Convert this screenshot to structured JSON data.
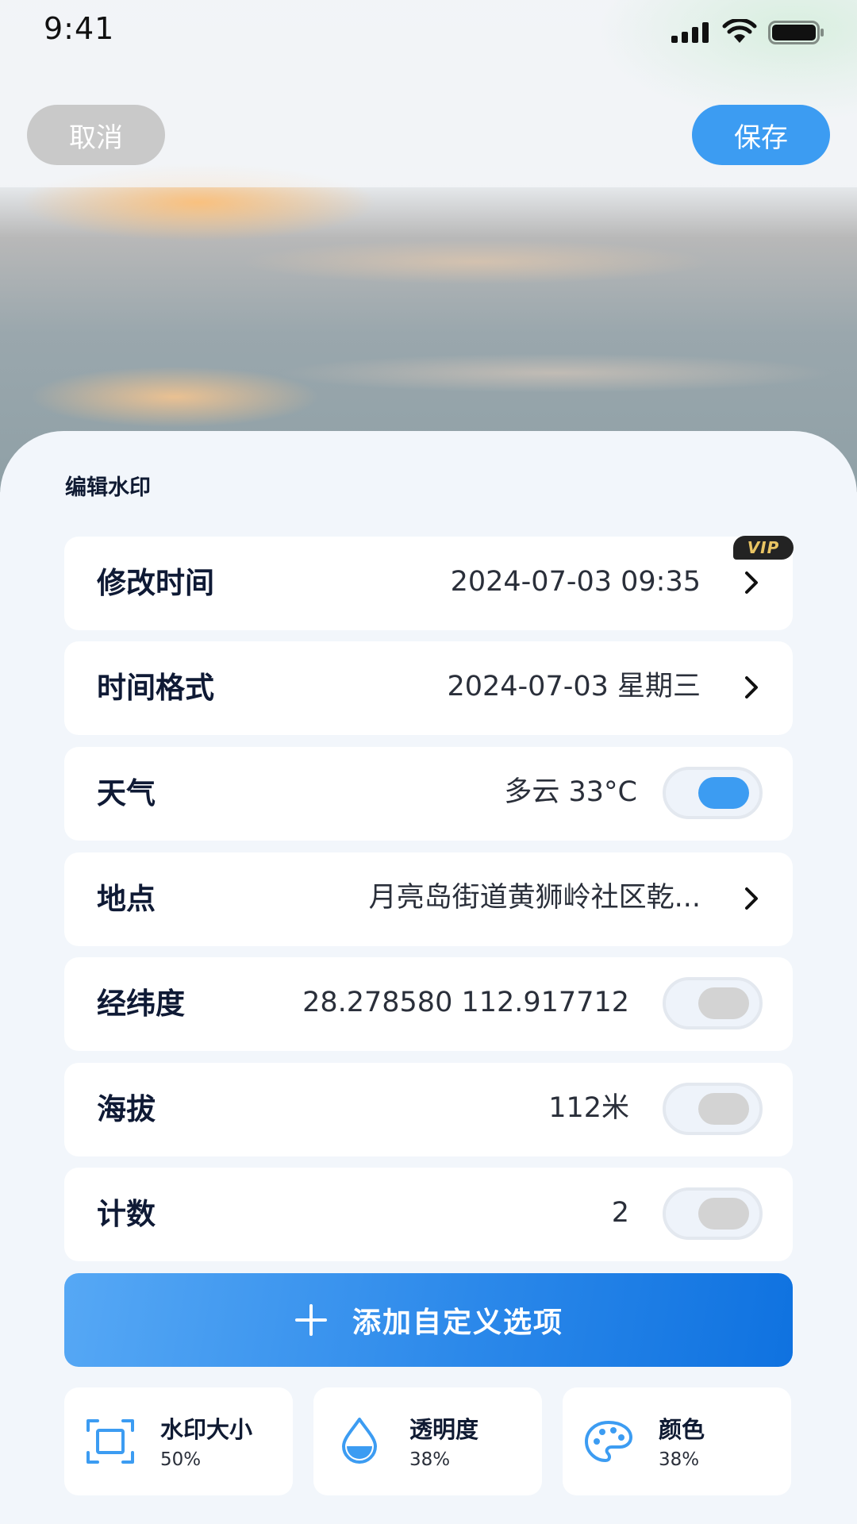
{
  "status_bar": {
    "time": "9:41"
  },
  "header": {
    "cancel_label": "取消",
    "save_label": "保存"
  },
  "sheet": {
    "title": "编辑水印"
  },
  "rows": [
    {
      "label": "修改时间",
      "value": "2024-07-03 09:35",
      "control": "chevron",
      "badge": "VIP"
    },
    {
      "label": "时间格式",
      "value": "2024-07-03 星期三",
      "control": "chevron"
    },
    {
      "label": "天气",
      "value": "多云 33°C",
      "control": "toggle",
      "enabled": true
    },
    {
      "label": "地点",
      "value": "月亮岛街道黄狮岭社区乾...",
      "control": "chevron"
    },
    {
      "label": "经纬度",
      "value": "28.278580  112.917712",
      "control": "toggle",
      "enabled": false
    },
    {
      "label": "海拔",
      "value": "112米",
      "control": "toggle",
      "enabled": false
    },
    {
      "label": "计数",
      "value": "2",
      "control": "toggle",
      "enabled": false
    }
  ],
  "add_button": {
    "label": "添加自定义选项"
  },
  "cards": [
    {
      "title": "水印大小",
      "value": "50%",
      "icon": "resize-frame-icon"
    },
    {
      "title": "透明度",
      "value": "38%",
      "icon": "water-drop-icon"
    },
    {
      "title": "颜色",
      "value": "38%",
      "icon": "palette-icon"
    }
  ],
  "colors": {
    "accent": "#3c9cf2",
    "cancel_bg": "#c9c9c9",
    "toggle_off_knob": "#d3d3d3",
    "vip_text": "#e9c463"
  }
}
